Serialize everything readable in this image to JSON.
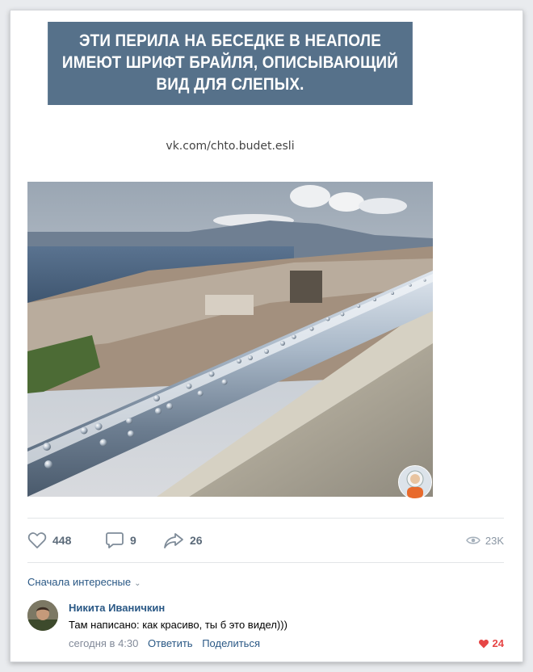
{
  "post": {
    "banner_lines": [
      "ЭТИ ПЕРИЛА НА БЕСЕДКЕ В НЕАПОЛЕ",
      "ИМЕЮТ ШРИФТ БРАЙЛЯ, ОПИСЫВАЮЩИЙ",
      "ВИД ДЛЯ СЛЕПЫХ."
    ],
    "watermark": "vk.com/chto.budet.esli",
    "photo_icon": "braille-railing-photo",
    "badge_icon": "astronaut-avatar-icon"
  },
  "actions": {
    "likes": "448",
    "comments": "9",
    "shares": "26",
    "views": "23K"
  },
  "comments_section": {
    "sort_label": "Сначала интересные",
    "items": [
      {
        "author": "Никита Иваничкин",
        "text": "Там написано: как красиво, ты б это видел)))",
        "time": "сегодня в 4:30",
        "reply_label": "Ответить",
        "share_label": "Поделиться",
        "likes": "24"
      }
    ]
  },
  "colors": {
    "banner_bg": "#56718a",
    "link": "#2a5885",
    "like_red": "#e64646",
    "icon_gray": "#5b6a79"
  }
}
